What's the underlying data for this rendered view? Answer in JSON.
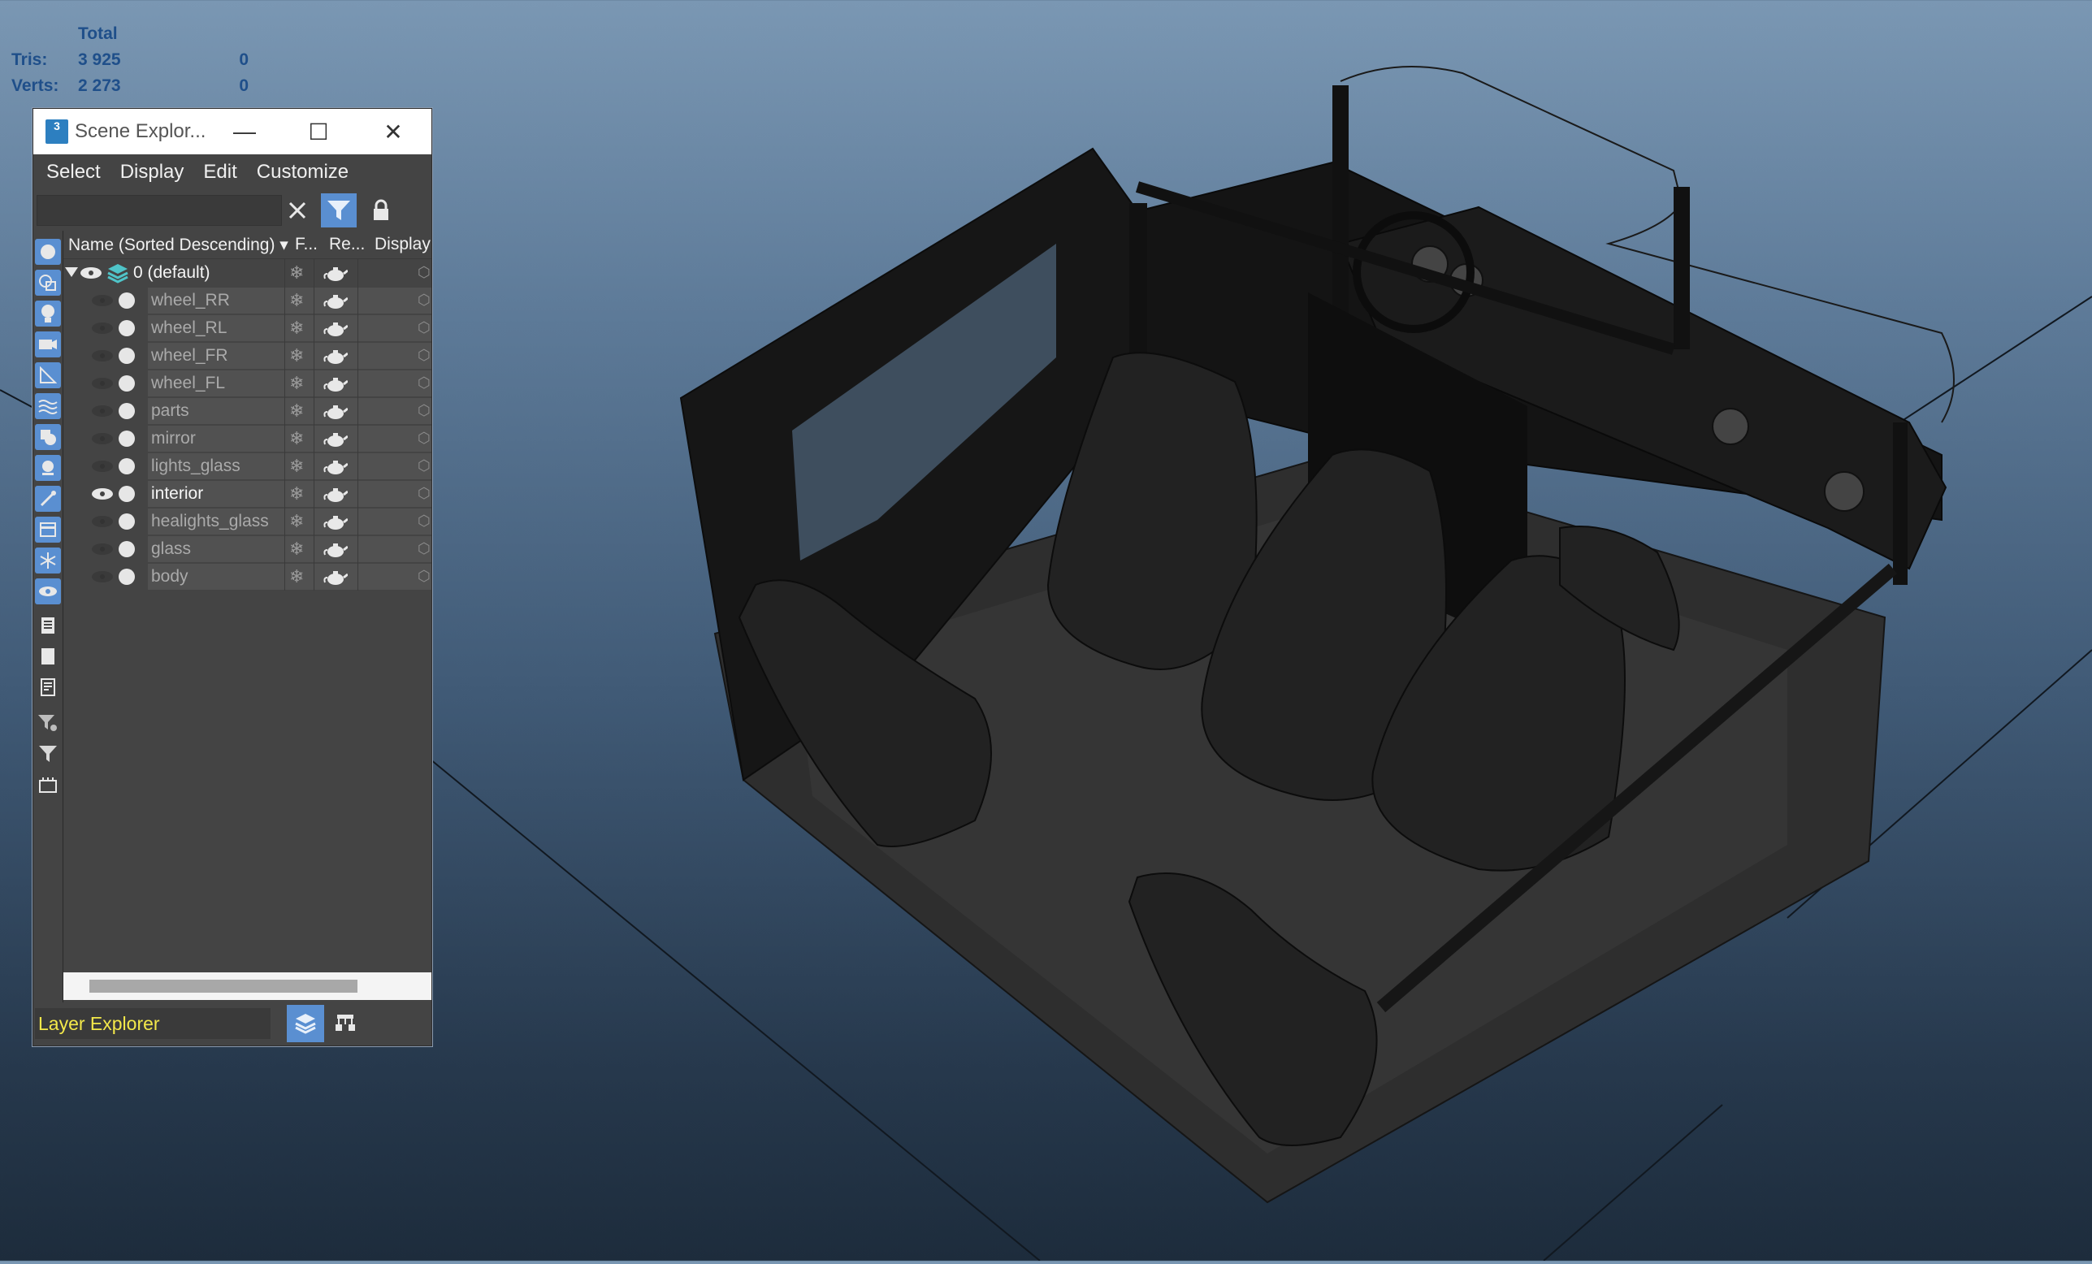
{
  "stats": {
    "header": "Total",
    "rows": [
      {
        "label": "Tris:",
        "value": "3 925",
        "selected": "0"
      },
      {
        "label": "Verts:",
        "value": "2 273",
        "selected": "0"
      }
    ]
  },
  "window": {
    "title": "Scene Explor...",
    "app_icon": "3",
    "controls": {
      "minimize": "—",
      "maximize": "☐",
      "close": "✕"
    }
  },
  "menu": [
    "Select",
    "Display",
    "Edit",
    "Customize"
  ],
  "search": {
    "value": "",
    "placeholder": ""
  },
  "columns": {
    "name": "Name (Sorted Descending)",
    "freeze": "F...",
    "render": "Re...",
    "display": "Display"
  },
  "layer_root": {
    "label": "0 (default)"
  },
  "objects": [
    {
      "label": "wheel_RR",
      "visible": false
    },
    {
      "label": "wheel_RL",
      "visible": false
    },
    {
      "label": "wheel_FR",
      "visible": false
    },
    {
      "label": "wheel_FL",
      "visible": false
    },
    {
      "label": "parts",
      "visible": false
    },
    {
      "label": "mirror",
      "visible": false
    },
    {
      "label": "lights_glass",
      "visible": false
    },
    {
      "label": "interior",
      "visible": true
    },
    {
      "label": "healights_glass",
      "visible": false
    },
    {
      "label": "glass",
      "visible": false
    },
    {
      "label": "body",
      "visible": false
    }
  ],
  "explorer_mode": "Layer Explorer",
  "colors": {
    "accent": "#5a8fd1",
    "stats_text": "#1f4f8a",
    "layer_text": "#f3e84a"
  }
}
